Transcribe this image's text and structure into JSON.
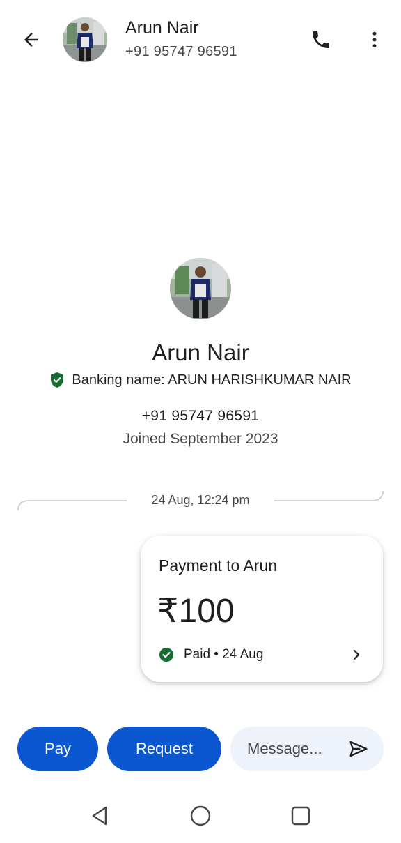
{
  "header": {
    "name": "Arun Nair",
    "phone": "+91 95747 96591",
    "icons": [
      "arrow-back-icon",
      "phone-icon",
      "more-vert-icon"
    ]
  },
  "profile": {
    "name": "Arun Nair",
    "banking_name": "Banking name: ARUN HARISHKUMAR NAIR",
    "phone": "+91 95747 96591",
    "joined": "Joined September 2023"
  },
  "conversation": {
    "timestamp": "24 Aug, 12:24 pm",
    "payment": {
      "title": "Payment to Arun",
      "amount": "₹100",
      "status": "Paid • 24 Aug"
    }
  },
  "actions": {
    "pay_label": "Pay",
    "request_label": "Request",
    "message_placeholder": "Message..."
  },
  "colors": {
    "primary": "#0b57d0",
    "verified_green": "#146c2e",
    "message_bg": "#eef2fa"
  }
}
